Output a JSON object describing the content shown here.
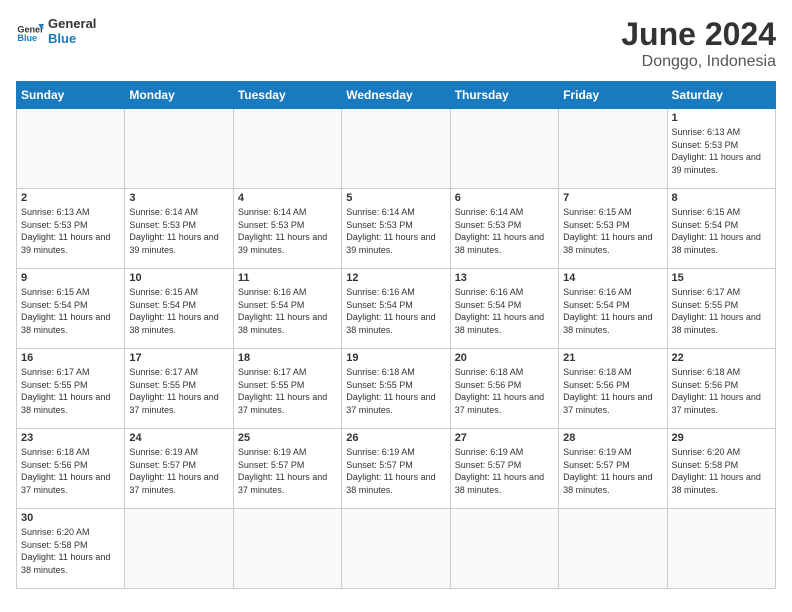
{
  "header": {
    "logo_general": "General",
    "logo_blue": "Blue",
    "month_year": "June 2024",
    "location": "Donggo, Indonesia"
  },
  "weekdays": [
    "Sunday",
    "Monday",
    "Tuesday",
    "Wednesday",
    "Thursday",
    "Friday",
    "Saturday"
  ],
  "weeks": [
    [
      {
        "day": "",
        "sunrise": "",
        "sunset": "",
        "daylight": ""
      },
      {
        "day": "",
        "sunrise": "",
        "sunset": "",
        "daylight": ""
      },
      {
        "day": "",
        "sunrise": "",
        "sunset": "",
        "daylight": ""
      },
      {
        "day": "",
        "sunrise": "",
        "sunset": "",
        "daylight": ""
      },
      {
        "day": "",
        "sunrise": "",
        "sunset": "",
        "daylight": ""
      },
      {
        "day": "",
        "sunrise": "",
        "sunset": "",
        "daylight": ""
      },
      {
        "day": "1",
        "sunrise": "6:13 AM",
        "sunset": "5:53 PM",
        "daylight": "11 hours and 39 minutes."
      }
    ],
    [
      {
        "day": "2",
        "sunrise": "6:13 AM",
        "sunset": "5:53 PM",
        "daylight": "11 hours and 39 minutes."
      },
      {
        "day": "3",
        "sunrise": "6:14 AM",
        "sunset": "5:53 PM",
        "daylight": "11 hours and 39 minutes."
      },
      {
        "day": "4",
        "sunrise": "6:14 AM",
        "sunset": "5:53 PM",
        "daylight": "11 hours and 39 minutes."
      },
      {
        "day": "5",
        "sunrise": "6:14 AM",
        "sunset": "5:53 PM",
        "daylight": "11 hours and 39 minutes."
      },
      {
        "day": "6",
        "sunrise": "6:14 AM",
        "sunset": "5:53 PM",
        "daylight": "11 hours and 38 minutes."
      },
      {
        "day": "7",
        "sunrise": "6:15 AM",
        "sunset": "5:53 PM",
        "daylight": "11 hours and 38 minutes."
      },
      {
        "day": "8",
        "sunrise": "6:15 AM",
        "sunset": "5:54 PM",
        "daylight": "11 hours and 38 minutes."
      }
    ],
    [
      {
        "day": "9",
        "sunrise": "6:15 AM",
        "sunset": "5:54 PM",
        "daylight": "11 hours and 38 minutes."
      },
      {
        "day": "10",
        "sunrise": "6:15 AM",
        "sunset": "5:54 PM",
        "daylight": "11 hours and 38 minutes."
      },
      {
        "day": "11",
        "sunrise": "6:16 AM",
        "sunset": "5:54 PM",
        "daylight": "11 hours and 38 minutes."
      },
      {
        "day": "12",
        "sunrise": "6:16 AM",
        "sunset": "5:54 PM",
        "daylight": "11 hours and 38 minutes."
      },
      {
        "day": "13",
        "sunrise": "6:16 AM",
        "sunset": "5:54 PM",
        "daylight": "11 hours and 38 minutes."
      },
      {
        "day": "14",
        "sunrise": "6:16 AM",
        "sunset": "5:54 PM",
        "daylight": "11 hours and 38 minutes."
      },
      {
        "day": "15",
        "sunrise": "6:17 AM",
        "sunset": "5:55 PM",
        "daylight": "11 hours and 38 minutes."
      }
    ],
    [
      {
        "day": "16",
        "sunrise": "6:17 AM",
        "sunset": "5:55 PM",
        "daylight": "11 hours and 38 minutes."
      },
      {
        "day": "17",
        "sunrise": "6:17 AM",
        "sunset": "5:55 PM",
        "daylight": "11 hours and 37 minutes."
      },
      {
        "day": "18",
        "sunrise": "6:17 AM",
        "sunset": "5:55 PM",
        "daylight": "11 hours and 37 minutes."
      },
      {
        "day": "19",
        "sunrise": "6:18 AM",
        "sunset": "5:55 PM",
        "daylight": "11 hours and 37 minutes."
      },
      {
        "day": "20",
        "sunrise": "6:18 AM",
        "sunset": "5:56 PM",
        "daylight": "11 hours and 37 minutes."
      },
      {
        "day": "21",
        "sunrise": "6:18 AM",
        "sunset": "5:56 PM",
        "daylight": "11 hours and 37 minutes."
      },
      {
        "day": "22",
        "sunrise": "6:18 AM",
        "sunset": "5:56 PM",
        "daylight": "11 hours and 37 minutes."
      }
    ],
    [
      {
        "day": "23",
        "sunrise": "6:18 AM",
        "sunset": "5:56 PM",
        "daylight": "11 hours and 37 minutes."
      },
      {
        "day": "24",
        "sunrise": "6:19 AM",
        "sunset": "5:57 PM",
        "daylight": "11 hours and 37 minutes."
      },
      {
        "day": "25",
        "sunrise": "6:19 AM",
        "sunset": "5:57 PM",
        "daylight": "11 hours and 37 minutes."
      },
      {
        "day": "26",
        "sunrise": "6:19 AM",
        "sunset": "5:57 PM",
        "daylight": "11 hours and 38 minutes."
      },
      {
        "day": "27",
        "sunrise": "6:19 AM",
        "sunset": "5:57 PM",
        "daylight": "11 hours and 38 minutes."
      },
      {
        "day": "28",
        "sunrise": "6:19 AM",
        "sunset": "5:57 PM",
        "daylight": "11 hours and 38 minutes."
      },
      {
        "day": "29",
        "sunrise": "6:20 AM",
        "sunset": "5:58 PM",
        "daylight": "11 hours and 38 minutes."
      }
    ],
    [
      {
        "day": "30",
        "sunrise": "6:20 AM",
        "sunset": "5:58 PM",
        "daylight": "11 hours and 38 minutes."
      },
      {
        "day": "",
        "sunrise": "",
        "sunset": "",
        "daylight": ""
      },
      {
        "day": "",
        "sunrise": "",
        "sunset": "",
        "daylight": ""
      },
      {
        "day": "",
        "sunrise": "",
        "sunset": "",
        "daylight": ""
      },
      {
        "day": "",
        "sunrise": "",
        "sunset": "",
        "daylight": ""
      },
      {
        "day": "",
        "sunrise": "",
        "sunset": "",
        "daylight": ""
      },
      {
        "day": "",
        "sunrise": "",
        "sunset": "",
        "daylight": ""
      }
    ]
  ]
}
